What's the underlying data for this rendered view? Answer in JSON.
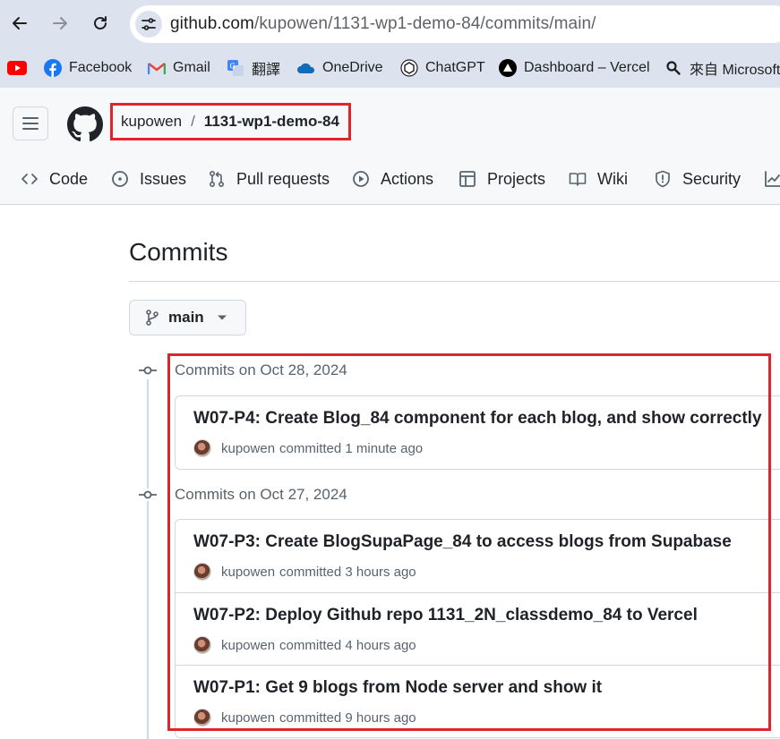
{
  "browser": {
    "url_host": "github.com",
    "url_path": "/kupowen/1131-wp1-demo-84/commits/main/",
    "bookmarks": [
      {
        "icon": "youtube-icon",
        "label": ""
      },
      {
        "icon": "facebook-icon",
        "label": "Facebook"
      },
      {
        "icon": "gmail-icon",
        "label": "Gmail"
      },
      {
        "icon": "translate-icon",
        "label": "翻譯"
      },
      {
        "icon": "onedrive-icon",
        "label": "OneDrive"
      },
      {
        "icon": "chatgpt-icon",
        "label": "ChatGPT"
      },
      {
        "icon": "vercel-icon",
        "label": "Dashboard – Vercel"
      },
      {
        "icon": "search-icon",
        "label": "來自 Microsoft"
      }
    ]
  },
  "header": {
    "owner": "kupowen",
    "separator": "/",
    "repo": "1131-wp1-demo-84",
    "tabs": [
      {
        "icon": "code-icon",
        "label": "Code"
      },
      {
        "icon": "issue-icon",
        "label": "Issues"
      },
      {
        "icon": "pull-request-icon",
        "label": "Pull requests"
      },
      {
        "icon": "play-icon",
        "label": "Actions"
      },
      {
        "icon": "table-icon",
        "label": "Projects"
      },
      {
        "icon": "book-icon",
        "label": "Wiki"
      },
      {
        "icon": "shield-icon",
        "label": "Security"
      }
    ]
  },
  "main": {
    "title": "Commits",
    "branch": "main",
    "groups": [
      {
        "heading": "Commits on Oct 28, 2024",
        "commits": [
          {
            "message": "W07-P4: Create Blog_84 component for each blog, and show correctly",
            "author": "kupowen",
            "action": "committed",
            "time": "1 minute ago"
          }
        ]
      },
      {
        "heading": "Commits on Oct 27, 2024",
        "commits": [
          {
            "message": "W07-P3: Create BlogSupaPage_84 to access blogs from Supabase",
            "author": "kupowen",
            "action": "committed",
            "time": "3 hours ago"
          },
          {
            "message": "W07-P2: Deploy Github repo 1131_2N_classdemo_84 to Vercel",
            "author": "kupowen",
            "action": "committed",
            "time": "4 hours ago"
          },
          {
            "message": "W07-P1: Get 9 blogs from Node server and show it",
            "author": "kupowen",
            "action": "committed",
            "time": "9 hours ago"
          }
        ]
      }
    ]
  },
  "colors": {
    "highlight": "#e0242c",
    "chrome": "#dde3ee",
    "header_bg": "#f6f8fa",
    "border": "#d1d9e0",
    "muted": "#59636e"
  }
}
